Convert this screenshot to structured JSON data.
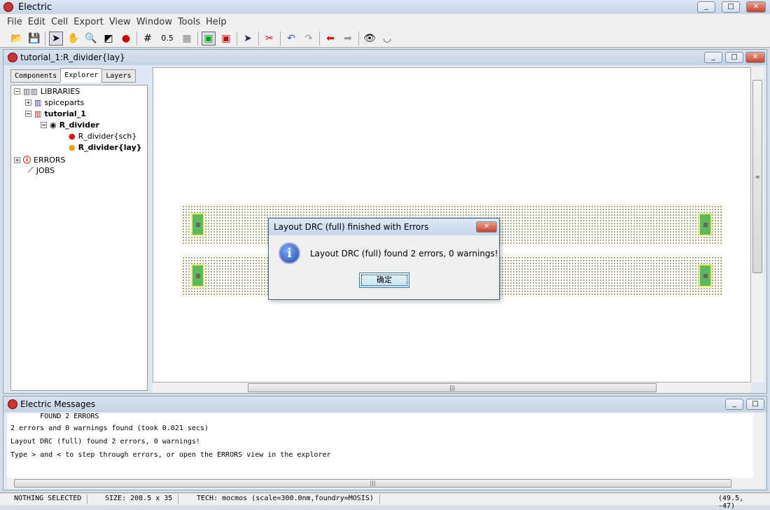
{
  "app": {
    "title": "Electric"
  },
  "menu": [
    "File",
    "Edit",
    "Cell",
    "Export",
    "View",
    "Window",
    "Tools",
    "Help"
  ],
  "toolbar": {
    "scale_label": "0.5",
    "icons": [
      "open-icon",
      "save-icon",
      "select-icon",
      "pan-icon",
      "zoom-icon",
      "outline-icon",
      "measure-icon",
      "grid-larger-icon",
      "grid-smaller-icon",
      "layout-icon",
      "schematic-icon",
      "select-special-icon",
      "cut-icon",
      "undo-icon",
      "redo-icon",
      "back-icon",
      "forward-icon",
      "show-icon",
      "hide-icon"
    ]
  },
  "editor": {
    "title": "tutorial_1:R_divider{lay}",
    "tabs": [
      "Components",
      "Explorer",
      "Layers"
    ],
    "tree": [
      {
        "label": "LIBRARIES",
        "bold": false
      },
      {
        "label": "spiceparts",
        "bold": false
      },
      {
        "label": "tutorial_1",
        "bold": true
      },
      {
        "label": "R_divider",
        "bold": true
      },
      {
        "label": "R_divider{sch}",
        "bold": false
      },
      {
        "label": "R_divider{lay}",
        "bold": true
      },
      {
        "label": "ERRORS",
        "bold": false
      },
      {
        "label": "JOBS",
        "bold": false
      }
    ]
  },
  "dialog": {
    "title": "Layout DRC (full) finished with Errors",
    "message": "Layout DRC (full) found 2 errors, 0 warnings!",
    "ok": "确定"
  },
  "messages": {
    "title": "Electric Messages",
    "lines": [
      "       FOUND 2 ERRORS",
      "2 errors and 0 warnings found (took 0.021 secs)",
      "Layout DRC (full) found 2 errors, 0 warnings!",
      "Type > and < to step through errors, or open the ERRORS view in the explorer"
    ]
  },
  "status": {
    "selection": "NOTHING SELECTED",
    "size": "SIZE: 208.5 x 35",
    "tech": "TECH: mocmos (scale=300.0nm,foundry=MOSIS)",
    "coords": "(49.5, -47)"
  }
}
